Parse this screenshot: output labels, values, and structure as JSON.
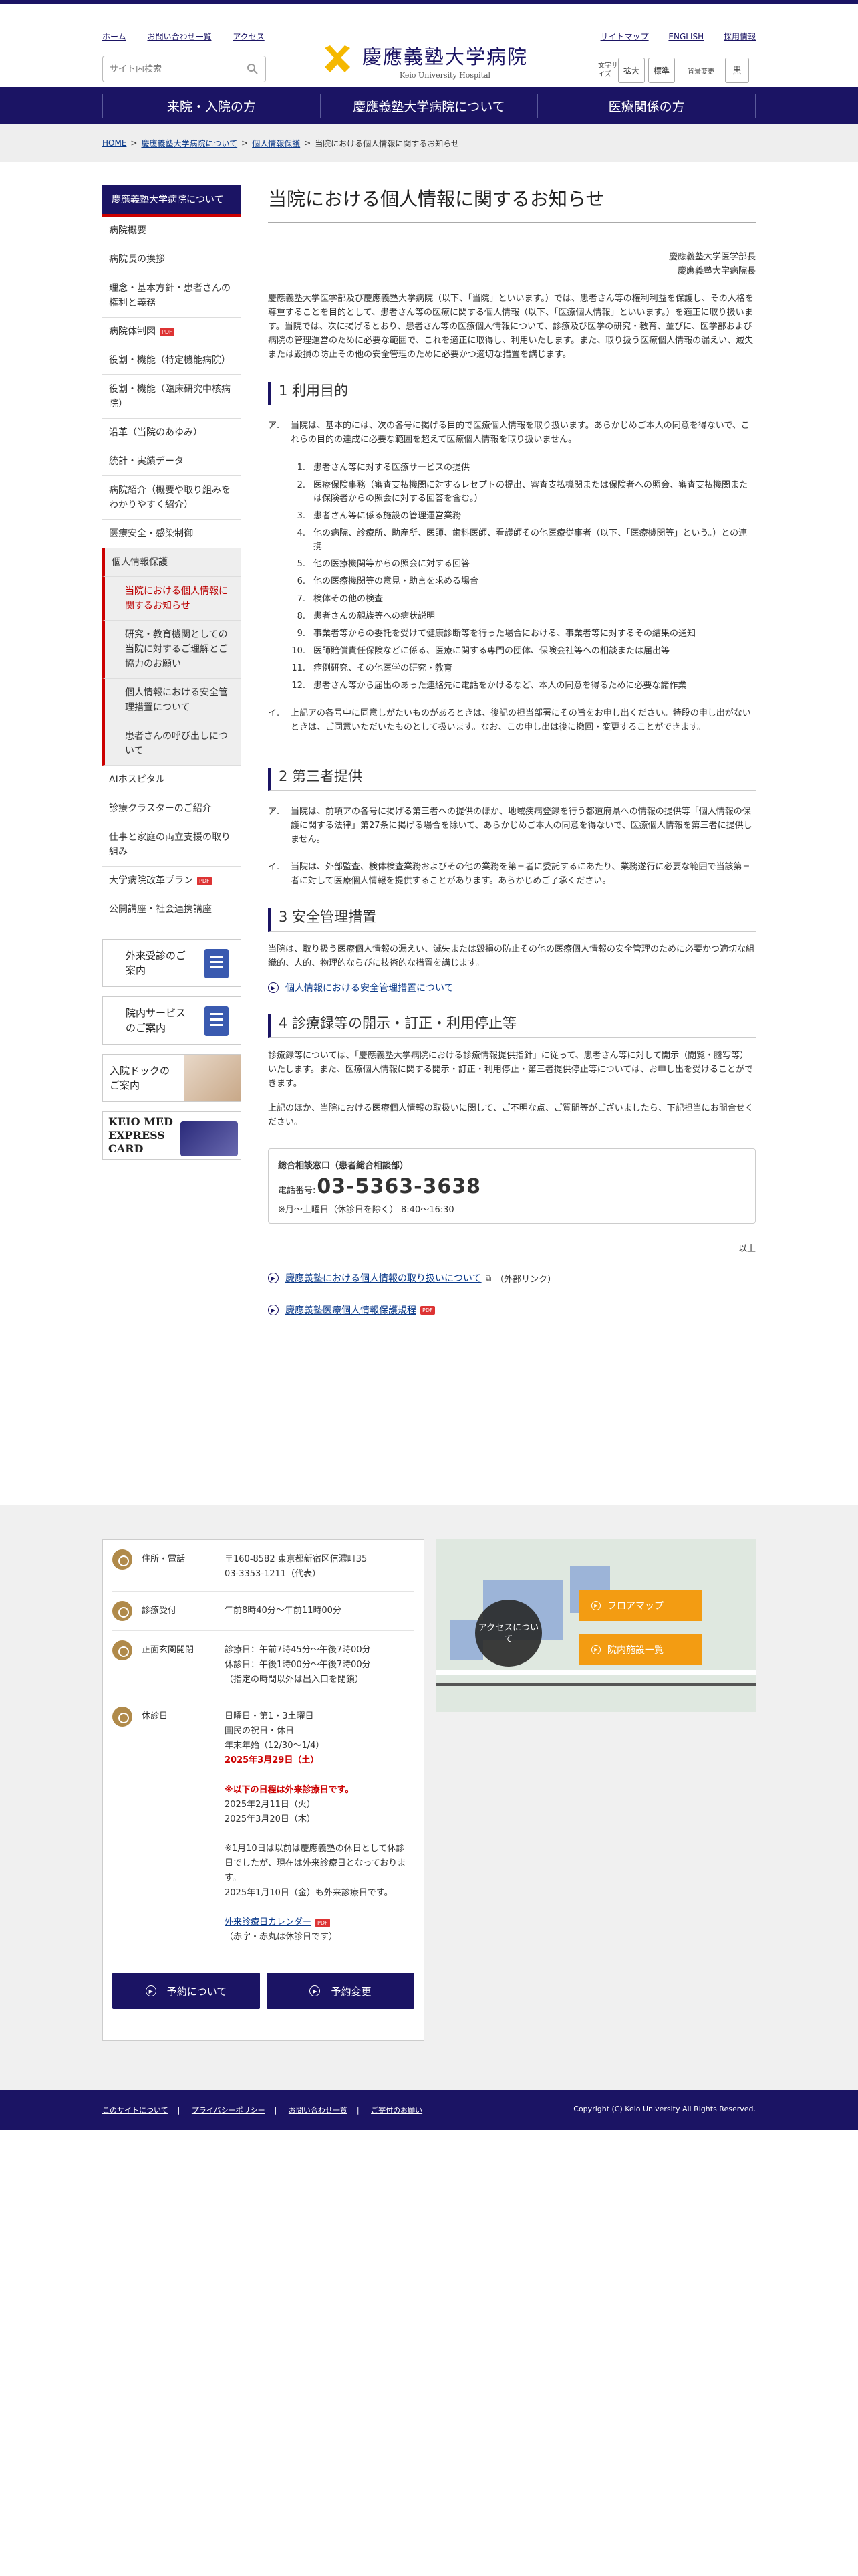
{
  "header": {
    "links": [
      "ホーム",
      "お問い合わせ一覧",
      "アクセス"
    ],
    "search_placeholder": "サイト内検索",
    "logo_jp": "慶應義塾大学病院",
    "logo_en": "Keio University Hospital",
    "right_links": [
      "サイトマップ",
      "ENGLISH",
      "採用情報"
    ],
    "font_label": "文字サイズ",
    "font_large": "拡大",
    "font_std": "標準",
    "bg_label": "背景変更",
    "bg_btn": "黒"
  },
  "nav": [
    "来院・入院の方",
    "慶應義塾大学病院について",
    "医療関係の方"
  ],
  "breadcrumb": [
    "HOME",
    "慶應義塾大学病院について",
    "個人情報保護",
    "当院における個人情報に関するお知らせ"
  ],
  "sidebar": {
    "title": "慶應義塾大学病院について",
    "items": [
      "病院概要",
      "病院長の挨拶",
      "理念・基本方針・患者さんの権利と義務",
      "病院体制図",
      "役割・機能（特定機能病院）",
      "役割・機能（臨床研究中核病院）",
      "沿革（当院のあゆみ）",
      "統計・実績データ",
      "病院紹介（概要や取り組みをわかりやすく紹介）",
      "医療安全・感染制御",
      "個人情報保護"
    ],
    "sub_items": [
      "当院における個人情報に関するお知らせ",
      "研究・教育機関としての当院に対するご理解とご協力のお願い",
      "個人情報における安全管理措置について",
      "患者さんの呼び出しについて"
    ],
    "items2": [
      "AIホスピタル",
      "診療クラスターのご紹介",
      "仕事と家庭の両立支援の取り組み",
      "大学病院改革プラン",
      "公開講座・社会連携講座"
    ]
  },
  "banners": [
    "外来受診のご案内",
    "院内サービスのご案内",
    "入院ドックのご案内",
    "KEIO MED EXPRESS CARD"
  ],
  "main": {
    "title": "当院における個人情報に関するお知らせ",
    "sig1": "慶應義塾大学医学部長",
    "sig2": "慶應義塾大学病院長",
    "intro": "慶應義塾大学医学部及び慶應義塾大学病院（以下、「当院」といいます。）では、患者さん等の権利利益を保護し、その人格を尊重することを目的として、患者さん等の医療に関する個人情報（以下、「医療個人情報」といいます。）を適正に取り扱います。当院では、次に掲げるとおり、患者さん等の医療個人情報について、診療及び医学の研究・教育、並びに、医学部および病院の管理運営のために必要な範囲で、これを適正に取得し、利用いたします。また、取り扱う医療個人情報の漏えい、滅失または毀損の防止その他の安全管理のために必要かつ適切な措置を講じます。",
    "h1": "1 利用目的",
    "s1a_mark": "ア.",
    "s1a": "当院は、基本的には、次の各号に掲げる目的で医療個人情報を取り扱います。あらかじめご本人の同意を得ないで、これらの目的の達成に必要な範囲を超えて医療個人情報を取り扱いません。",
    "purposes": [
      "患者さん等に対する医療サービスの提供",
      "医療保険事務（審査支払機関に対するレセプトの提出、審査支払機関または保険者への照会、審査支払機関または保険者からの照会に対する回答を含む。）",
      "患者さん等に係る施設の管理運営業務",
      "他の病院、診療所、助産所、医師、歯科医師、看護師その他医療従事者（以下、「医療機関等」という。）との連携",
      "他の医療機関等からの照会に対する回答",
      "他の医療機関等の意見・助言を求める場合",
      "検体その他の検査",
      "患者さんの親族等への病状説明",
      "事業者等からの委託を受けて健康診断等を行った場合における、事業者等に対するその結果の通知",
      "医師賠償責任保険などに係る、医療に関する専門の団体、保険会社等への相談または届出等",
      "症例研究、その他医学の研究・教育",
      "患者さん等から届出のあった連絡先に電話をかけるなど、本人の同意を得るために必要な諸作業"
    ],
    "s1b_mark": "イ.",
    "s1b": "上記アの各号中に同意しがたいものがあるときは、後記の担当部署にその旨をお申し出ください。特段の申し出がないときは、ご同意いただいたものとして扱います。なお、この申し出は後に撤回・変更することができます。",
    "h2": "2 第三者提供",
    "s2a_mark": "ア.",
    "s2a": "当院は、前項アの各号に掲げる第三者への提供のほか、地域疾病登録を行う都道府県への情報の提供等「個人情報の保護に関する法律」第27条に掲げる場合を除いて、あらかじめご本人の同意を得ないで、医療個人情報を第三者に提供しません。",
    "s2b_mark": "イ.",
    "s2b": "当院は、外部監査、検体検査業務およびその他の業務を第三者に委託するにあたり、業務遂行に必要な範囲で当該第三者に対して医療個人情報を提供することがあります。あらかじめご了承ください。",
    "h3": "3 安全管理措置",
    "s3": "当院は、取り扱う医療個人情報の漏えい、滅失または毀損の防止その他の医療個人情報の安全管理のために必要かつ適切な組織的、人的、物理的ならびに技術的な措置を講じます。",
    "l3": "個人情報における安全管理措置について",
    "h4": "4 診療録等の開示・訂正・利用停止等",
    "s4a": "診療録等については、「慶應義塾大学病院における診療情報提供指針」に従って、患者さん等に対して開示（閲覧・謄写等）いたします。また、医療個人情報に関する開示・訂正・利用停止・第三者提供停止等については、お申し出を受けることができます。",
    "s4b": "上記のほか、当院における医療個人情報の取扱いに関して、ご不明な点、ご質問等がございましたら、下記担当にお問合せください。",
    "contact_title": "総合相談窓口（患者総合相談部）",
    "contact_tel_label": "電話番号:",
    "contact_tel": "03-5363-3638",
    "contact_hours": "※月〜土曜日（休診日を除く） 8:40〜16:30",
    "ijo": "以上",
    "link1": "慶應義塾における個人情報の取り扱いについて",
    "link1_ext": "（外部リンク）",
    "link2": "慶應義塾医療個人情報保護規程"
  },
  "footer": {
    "rows": [
      {
        "label": "住所・電話",
        "value": [
          "〒160-8582 東京都新宿区信濃町35",
          "03-3353-1211（代表）"
        ]
      },
      {
        "label": "診療受付",
        "value": [
          "午前8時40分〜午前11時00分"
        ]
      },
      {
        "label": "正面玄関開閉",
        "value": [
          "診療日：午前7時45分〜午後7時00分",
          "休診日：午後1時00分〜午後7時00分",
          "（指定の時間以外は出入口を閉鎖）"
        ]
      }
    ],
    "holiday_label": "休診日",
    "holiday": [
      "日曜日・第1・3土曜日",
      "国民の祝日・休日",
      "年末年始（12/30〜1/4）"
    ],
    "holiday_red1": "2025年3月29日（土）",
    "holiday_red2": "※以下の日程は外来診療日です。",
    "holiday_more": [
      "2025年2月11日（火）",
      "2025年3月20日（木）"
    ],
    "holiday_note": [
      "※1月10日は以前は慶應義塾の休日として休診日でしたが、現在は外来診療日となっております。",
      "2025年1月10日（金）も外来診療日です。"
    ],
    "calendar_link": "外来診療日カレンダー",
    "calendar_note": "（赤字・赤丸は休診日です）",
    "btn1": "予約について",
    "btn2": "予約変更",
    "map_access": "アクセスについて",
    "map_btn1": "フロアマップ",
    "map_btn2": "院内施設一覧"
  },
  "bottom": {
    "links": [
      "このサイトについて",
      "プライバシーポリシー",
      "お問い合わせ一覧",
      "ご寄付のお願い"
    ],
    "copyright": "Copyright (C) Keio University All Rights Reserved."
  }
}
